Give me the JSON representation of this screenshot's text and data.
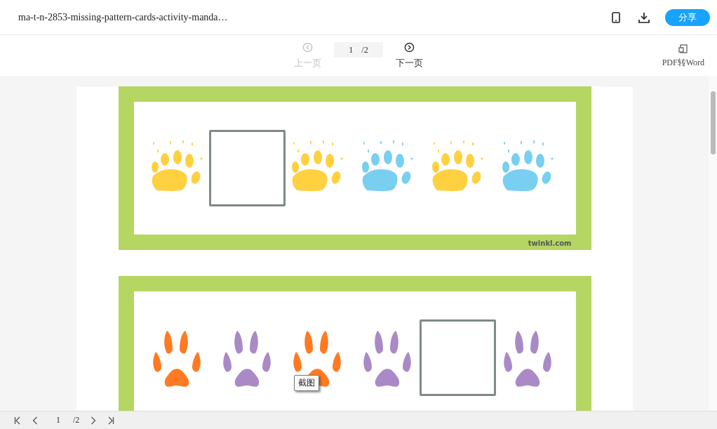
{
  "header": {
    "title": "ma-t-n-2853-missing-pattern-cards-activity-manda…",
    "share_button": "分享"
  },
  "toolbar": {
    "prev": {
      "label": "上一页",
      "disabled": true
    },
    "page_input": "1",
    "page_total": "/2",
    "next": {
      "label": "下一页",
      "disabled": false
    },
    "convert": "PDF转Word"
  },
  "cards": [
    {
      "credit": "twinkl.com",
      "items": [
        {
          "kind": "bear-paw",
          "color": "#ffd040"
        },
        {
          "kind": "blank"
        },
        {
          "kind": "bear-paw",
          "color": "#ffd040"
        },
        {
          "kind": "bear-paw",
          "color": "#78cff0"
        },
        {
          "kind": "bear-paw",
          "color": "#ffd040"
        },
        {
          "kind": "bear-paw",
          "color": "#78cff0"
        }
      ]
    },
    {
      "items": [
        {
          "kind": "cat-paw",
          "color": "#ff7a22"
        },
        {
          "kind": "cat-paw",
          "color": "#a98ac7"
        },
        {
          "kind": "cat-paw",
          "color": "#ff7a22"
        },
        {
          "kind": "cat-paw",
          "color": "#a98ac7"
        },
        {
          "kind": "blank"
        },
        {
          "kind": "cat-paw",
          "color": "#a98ac7"
        }
      ]
    }
  ],
  "tooltip": "截图",
  "bottom_bar": {
    "page_input": "1",
    "page_total": "/2"
  }
}
